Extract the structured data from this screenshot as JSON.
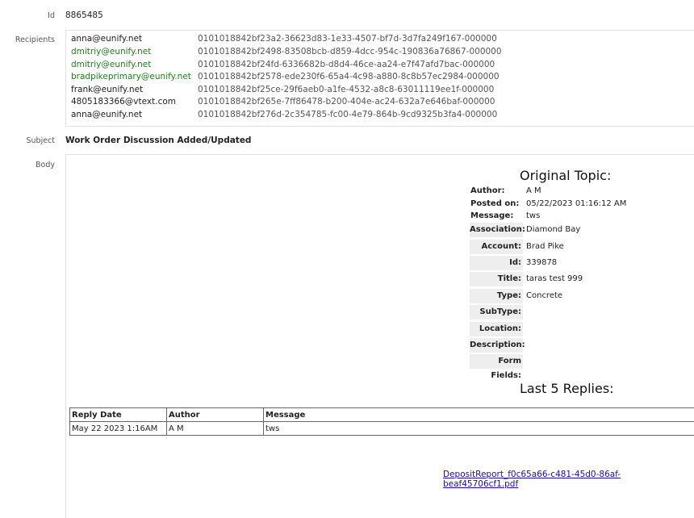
{
  "fields": {
    "id_label": "Id",
    "id_value": "8865485",
    "recipients_label": "Recipients",
    "subject_label": "Subject",
    "subject_value": "Work Order Discussion Added/Updated",
    "body_label": "Body"
  },
  "recipients": [
    {
      "email": "anna@eunify.net",
      "id": "0101018842bf23a2-36623d83-1e33-4507-bf7d-3d7fa249f167-000000",
      "color": "#222222"
    },
    {
      "email": "dmitriy@eunify.net",
      "id": "0101018842bf2498-83508bcb-d859-4dcc-954c-190836a76867-000000",
      "color": "#1e7e1e"
    },
    {
      "email": "dmitriy@eunify.net",
      "id": "0101018842bf24fd-6336682b-d8d4-46ce-aa24-e7f47afd7bac-000000",
      "color": "#1e7e1e"
    },
    {
      "email": "bradpikeprimary@eunify.net",
      "id": "0101018842bf2578-ede230f6-65a4-4c98-a880-8c8b57ec2984-000000",
      "color": "#1e7e1e"
    },
    {
      "email": "frank@eunify.net",
      "id": "0101018842bf25ce-29f6aeb0-a1fe-4532-a8c8-63011119ee1f-000000",
      "color": "#222222"
    },
    {
      "email": "4805183366@vtext.com",
      "id": "0101018842bf265e-7ff86478-b200-404e-ac24-632a7e646baf-000000",
      "color": "#222222"
    },
    {
      "email": "anna@eunify.net",
      "id": "0101018842bf276d-2c354785-fc00-4e79-864b-9cd9325b3fa4-000000",
      "color": "#222222"
    }
  ],
  "body": {
    "original_topic_heading": "Original Topic:",
    "author_label": "Author:",
    "author_value": "A M",
    "posted_label": "Posted on:",
    "posted_value": "05/22/2023 01:16:12 AM",
    "message_label": "Message:",
    "message_value": "tws",
    "details": [
      {
        "label": "Association:",
        "value": "Diamond Bay"
      },
      {
        "label": "Account:",
        "value": "Brad Pike"
      },
      {
        "label": "Id:",
        "value": "339878"
      },
      {
        "label": "Title:",
        "value": "taras test 999"
      },
      {
        "label": "Type:",
        "value": "Concrete"
      },
      {
        "label": "SubType:",
        "value": ""
      },
      {
        "label": "Location:",
        "value": ""
      },
      {
        "label": "Description:",
        "value": ""
      },
      {
        "label": "Form Fields:",
        "value": ""
      }
    ],
    "replies_heading": "Last 5 Replies:",
    "replies_headers": [
      "Reply Date",
      "Author",
      "Message"
    ],
    "replies_rows": [
      [
        "May 22 2023 1:16AM",
        "A M",
        "tws"
      ]
    ],
    "attachment": "DepositReport_f0c65a66-c481-45d0-86af-beaf45706cf1.pdf"
  },
  "colors": {
    "link": "#1a0dab",
    "highlight_email": "#1e7e1e",
    "label_bg": "#eeeeee"
  }
}
